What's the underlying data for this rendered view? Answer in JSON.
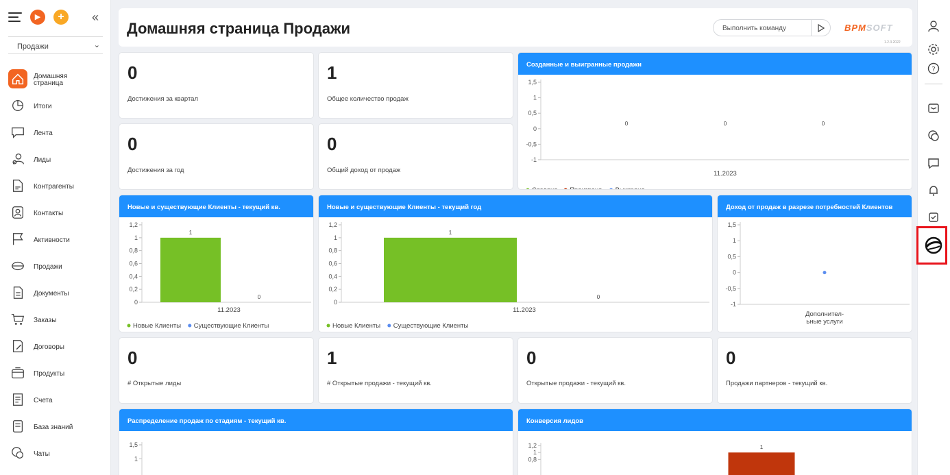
{
  "sidebar": {
    "workspace": "Продажи",
    "items": [
      {
        "label": "Домашняя\nстраница",
        "icon": "home-icon"
      },
      {
        "label": "Итоги",
        "icon": "pie-chart-icon"
      },
      {
        "label": "Лента",
        "icon": "feed-icon"
      },
      {
        "label": "Лиды",
        "icon": "leads-icon"
      },
      {
        "label": "Контрагенты",
        "icon": "accounts-icon"
      },
      {
        "label": "Контакты",
        "icon": "contacts-icon"
      },
      {
        "label": "Активности",
        "icon": "flag-icon"
      },
      {
        "label": "Продажи",
        "icon": "opportunities-icon"
      },
      {
        "label": "Документы",
        "icon": "documents-icon"
      },
      {
        "label": "Заказы",
        "icon": "cart-icon"
      },
      {
        "label": "Договоры",
        "icon": "contracts-icon"
      },
      {
        "label": "Продукты",
        "icon": "products-icon"
      },
      {
        "label": "Счета",
        "icon": "invoices-icon"
      },
      {
        "label": "База знаний",
        "icon": "knowledge-base-icon"
      },
      {
        "label": "Чаты",
        "icon": "chats-icon"
      }
    ]
  },
  "header": {
    "title": "Домашняя страница Продажи",
    "command_placeholder": "Выполнить команду",
    "logo_part1": "BPM",
    "logo_part2": "SOFT",
    "version": "1.2.3.2022"
  },
  "metrics": {
    "m1": {
      "value": "0",
      "caption": "Достижения за квартал"
    },
    "m2": {
      "value": "1",
      "caption": "Общее количество продаж"
    },
    "m3": {
      "value": "0",
      "caption": "Достижения за год"
    },
    "m4": {
      "value": "0",
      "caption": "Общий доход от продаж"
    },
    "m5": {
      "value": "0",
      "caption": "# Открытые лиды"
    },
    "m6": {
      "value": "1",
      "caption": "# Открытые продажи - текущий кв."
    },
    "m7": {
      "value": "0",
      "caption": "Открытые продажи - текущий кв."
    },
    "m8": {
      "value": "0",
      "caption": "Продажи партнеров - текущий кв."
    }
  },
  "colors": {
    "accent": "#1e90ff",
    "green": "#76c026",
    "blue": "#5b8def",
    "red": "#c0360c",
    "orange": "#f26522"
  },
  "chart_data": [
    {
      "title": "Созданные и выигранные продажи",
      "type": "bar",
      "categories": [
        "11.2023"
      ],
      "series": [
        {
          "name": "Создано",
          "values": [
            0
          ],
          "color": "#76c026"
        },
        {
          "name": "Проиграно",
          "values": [
            0
          ],
          "color": "#c0360c"
        },
        {
          "name": "Выиграно",
          "values": [
            0
          ],
          "color": "#5b8def"
        }
      ],
      "yticks": [
        "1,5",
        "1",
        "0,5",
        "0",
        "-0,5",
        "-1"
      ],
      "ylim": [
        -1,
        1.5
      ]
    },
    {
      "title": "Новые и существующие Клиенты - текущий кв.",
      "type": "bar",
      "categories": [
        "11.2023"
      ],
      "series": [
        {
          "name": "Новые Клиенты",
          "values": [
            1
          ],
          "color": "#76c026"
        },
        {
          "name": "Существующие Клиенты",
          "values": [
            0
          ],
          "color": "#5b8def"
        }
      ],
      "yticks": [
        "1,2",
        "1",
        "0,8",
        "0,6",
        "0,4",
        "0,2",
        "0"
      ],
      "ylim": [
        0,
        1.2
      ]
    },
    {
      "title": "Новые и существующие Клиенты - текущий год",
      "type": "bar",
      "categories": [
        "11.2023"
      ],
      "series": [
        {
          "name": "Новые Клиенты",
          "values": [
            1
          ],
          "color": "#76c026"
        },
        {
          "name": "Существующие Клиенты",
          "values": [
            0
          ],
          "color": "#5b8def"
        }
      ],
      "yticks": [
        "1,2",
        "1",
        "0,8",
        "0,6",
        "0,4",
        "0,2",
        "0"
      ],
      "ylim": [
        0,
        1.2
      ]
    },
    {
      "title": "Доход от продаж в разрезе потребностей Клиентов",
      "type": "scatter",
      "categories": [
        "Дополнител-\nьные услуги"
      ],
      "series": [
        {
          "name": "",
          "values": [
            0
          ],
          "color": "#5b8def"
        }
      ],
      "yticks": [
        "1,5",
        "1",
        "0,5",
        "0",
        "-0,5",
        "-1"
      ],
      "ylim": [
        -1,
        1.5
      ]
    },
    {
      "title": "Распределение продаж по стадиям - текущий кв.",
      "type": "bar",
      "yticks": [
        "1,5",
        "1"
      ],
      "ylim": [
        0,
        1.5
      ]
    },
    {
      "title": "Конверсия лидов",
      "type": "bar",
      "series": [
        {
          "name": "",
          "values": [
            1
          ],
          "color": "#c0360c"
        }
      ],
      "yticks": [
        "1,2",
        "1",
        "0,8"
      ],
      "ylim": [
        0,
        1.2
      ]
    }
  ]
}
